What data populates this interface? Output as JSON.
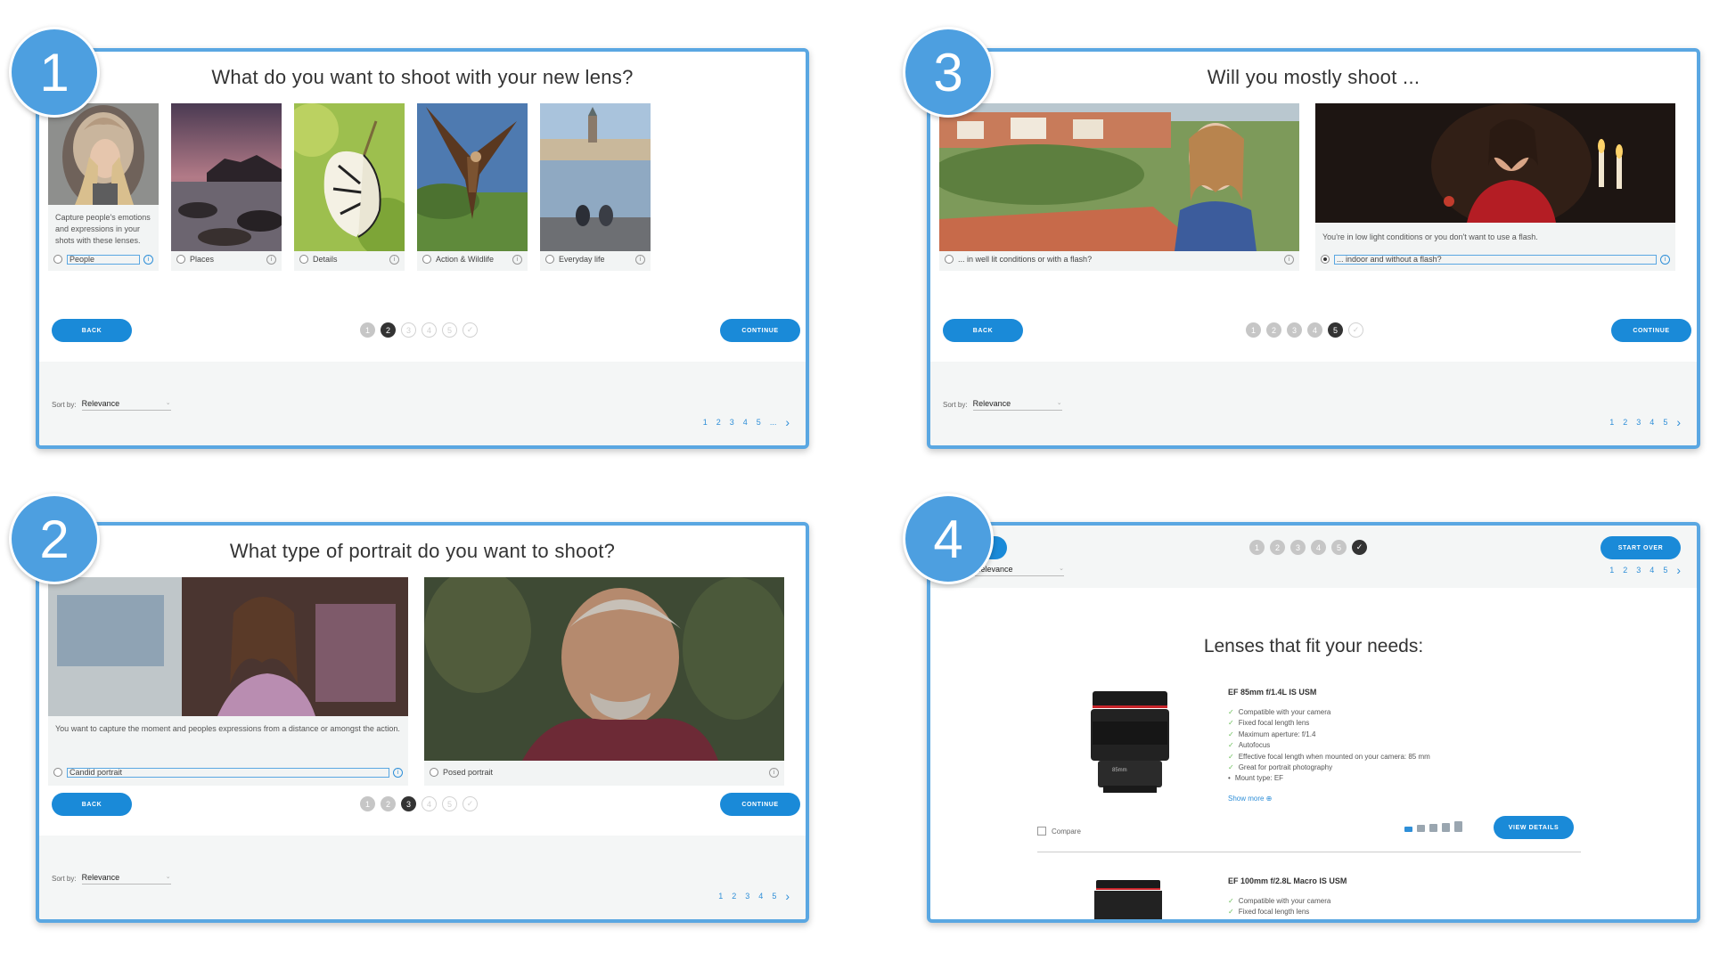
{
  "panel1": {
    "number": "1",
    "question": "What do you want to shoot with your new lens?",
    "cards": [
      {
        "label": "People",
        "desc": "Capture people's emotions and expressions in your shots with these lenses.",
        "selected": true
      },
      {
        "label": "Places",
        "selected": false
      },
      {
        "label": "Details",
        "selected": false
      },
      {
        "label": "Action & Wildlife",
        "selected": false
      },
      {
        "label": "Everyday life",
        "selected": false
      }
    ],
    "back": "BACK",
    "continue": "CONTINUE",
    "steps": [
      "1",
      "2",
      "3",
      "4",
      "5",
      "✓"
    ],
    "current_step": "2",
    "sort_label": "Sort by:",
    "sort_value": "Relevance",
    "pages": [
      "1",
      "2",
      "3",
      "4",
      "5",
      "..."
    ]
  },
  "panel2": {
    "number": "2",
    "question": "What type of portrait do you want to shoot?",
    "cards": [
      {
        "label": "Candid portrait",
        "desc": "You want to capture the moment and peoples expressions from a distance or amongst the action.",
        "selected": true
      },
      {
        "label": "Posed portrait",
        "selected": false
      }
    ],
    "back": "BACK",
    "continue": "CONTINUE",
    "steps": [
      "1",
      "2",
      "3",
      "4",
      "5",
      "✓"
    ],
    "current_step": "3",
    "sort_label": "Sort by:",
    "sort_value": "Relevance",
    "pages": [
      "1",
      "2",
      "3",
      "4",
      "5"
    ]
  },
  "panel3": {
    "number": "3",
    "question": "Will you mostly shoot ...",
    "cards": [
      {
        "label": "... in well lit conditions or with a flash?",
        "selected": false
      },
      {
        "label": "... indoor and without a flash?",
        "desc": "You're in low light conditions or you don't want to use a flash.",
        "selected": true
      }
    ],
    "back": "BACK",
    "continue": "CONTINUE",
    "steps": [
      "1",
      "2",
      "3",
      "4",
      "5",
      "✓"
    ],
    "current_step": "5",
    "sort_label": "Sort by:",
    "sort_value": "Relevance",
    "pages": [
      "1",
      "2",
      "3",
      "4",
      "5"
    ]
  },
  "panel4": {
    "number": "4",
    "start_over": "START OVER",
    "steps": [
      "1",
      "2",
      "3",
      "4",
      "5",
      "✓"
    ],
    "current_step": "✓",
    "sort_value": "Relevance",
    "pages": [
      "1",
      "2",
      "3",
      "4",
      "5"
    ],
    "results_title": "Lenses that fit your needs:",
    "lens1": {
      "name": "EF 85mm f/1.4L IS USM",
      "features": [
        "Compatible with your camera",
        "Fixed focal length lens",
        "Maximum aperture: f/1.4",
        "Autofocus",
        "Effective focal length when mounted on your camera: 85 mm",
        "Great for portrait photography"
      ],
      "mount": "Mount type: EF",
      "show_more": "Show more ⊕",
      "compare": "Compare",
      "view_details": "VIEW DETAILS",
      "lens_text": "85mm"
    },
    "lens2": {
      "name": "EF 100mm f/2.8L Macro IS USM",
      "features": [
        "Compatible with your camera",
        "Fixed focal length lens"
      ]
    }
  }
}
